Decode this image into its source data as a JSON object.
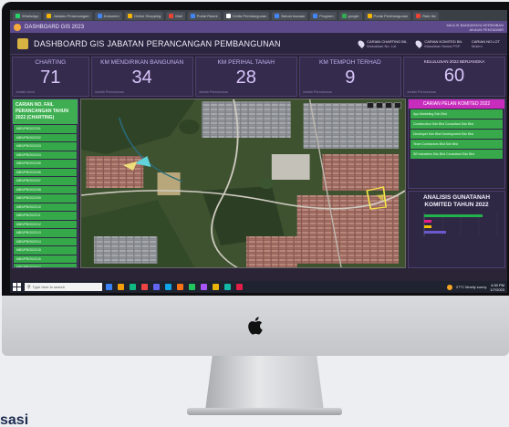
{
  "browser": {
    "tabs": [
      {
        "label": "WhatsApp",
        "color": "#25d366"
      },
      {
        "label": "Jabatan Perancangan",
        "color": "#f4b400"
      },
      {
        "label": "Dokumen",
        "color": "#4285f4"
      },
      {
        "label": "Online Shopping",
        "color": "#f4b400"
      },
      {
        "label": "Mail",
        "color": "#ea4335"
      },
      {
        "label": "Portal Rasmi",
        "color": "#4285f4"
      },
      {
        "label": "Cerita Pembangunan",
        "color": "#ffffff"
      },
      {
        "label": "Bahan bacaan",
        "color": "#4285f4"
      },
      {
        "label": "Program",
        "color": "#4285f4"
      },
      {
        "label": "google",
        "color": "#34a853"
      },
      {
        "label": "Portal Pembangunan",
        "color": "#f4b400"
      },
      {
        "label": "Rate list",
        "color": "#ea4335"
      }
    ]
  },
  "app": {
    "title": "DASHBOARD GIS 2023",
    "user_name": "MAJLIS BANDARAYA SEREMBAN",
    "user_role": "AKAUN PENTADBIR"
  },
  "dashboard": {
    "title": "DASHBOARD GIS JABATAN PERANCANGAN PEMBANGUNAN",
    "filters": [
      {
        "label": "CARIAN CHARTING BIL",
        "value": "Masukkan No. Lot"
      },
      {
        "label": "CARIAN KOMITED BIL",
        "value": "Masukkan Nama PSP"
      },
      {
        "label": "CARIAN NO LOT",
        "value": "Mukim"
      }
    ]
  },
  "kpis": [
    {
      "label": "CHARTING",
      "value": "71",
      "foot": "Jumlah rekod"
    },
    {
      "label": "KM MENDIRIKAN BANGUNAN",
      "value": "34",
      "foot": "Jumlah Permohonan"
    },
    {
      "label": "KM PERIHAL TANAH",
      "value": "28",
      "foot": "Jumlah Permohonan"
    },
    {
      "label": "KM TEMPOH TERHAD",
      "value": "9",
      "foot": "Jumlah Permohonan"
    },
    {
      "label": "KELULUSAN 2022 BERJANGKA",
      "value": "60",
      "foot": "Jumlah Permohonan"
    }
  ],
  "left_panel": {
    "title": "CARIAN NO. FAIL PERANCANGAN TAHUN 2022 (CHARTING)",
    "rows": [
      "MBS/PB/2022/01",
      "MBS/PB/2022/02",
      "MBS/PB/2022/03",
      "MBS/PB/2022/04",
      "MBS/PB/2022/05",
      "MBS/PB/2022/06",
      "MBS/PB/2022/07",
      "MBS/PB/2022/08",
      "MBS/PB/2022/09",
      "MBS/PB/2022/10",
      "MBS/PB/2022/11",
      "MBS/PB/2022/12",
      "MBS/PB/2022/13",
      "MBS/PB/2022/14",
      "MBS/PB/2022/15",
      "MBS/PB/2022/16",
      "MBS/PB/2022/17",
      "MBS/PB/2022/18"
    ]
  },
  "right_panel": {
    "list_title": "CARIAN PELAN KOMITED 2022",
    "list_rows": [
      "Ayu Marketing Sdn Bhd",
      "Construction Sdn Bhd Consultant Sdn Bhd",
      "Developer Sdn Bhd Development Sdn Bhd",
      "Team Contractors Bhd Sdn Bhd",
      "SB Industries Sdn Bhd Consultant Sdn Bhd"
    ],
    "chart_title": "ANALISIS GUNATANAH KOMITED TAHUN 2022"
  },
  "chart_data": {
    "type": "bar",
    "orientation": "horizontal",
    "title": "ANALISIS GUNATANAH KOMITED TAHUN 2022",
    "series": [
      {
        "values": [
          8,
          1,
          1,
          3
        ],
        "colors": [
          "#22b14c",
          "#e91e8c",
          "#f2c200",
          "#6a5acd"
        ]
      }
    ],
    "xlim": [
      0,
      10
    ],
    "grid": true,
    "legend": "none"
  },
  "taskbar": {
    "search_placeholder": "Type here to search",
    "tray_weather": "27°C Mostly sunny",
    "time": "4:30 PM",
    "date": "1/7/2023",
    "icon_colors": [
      "#3b82f6",
      "#f59e0b",
      "#10b981",
      "#ef4444",
      "#6366f1",
      "#0ea5e9",
      "#f97316",
      "#22c55e",
      "#a855f7",
      "#eab308",
      "#14b8a6",
      "#e11d48"
    ]
  },
  "caption": "sasi"
}
